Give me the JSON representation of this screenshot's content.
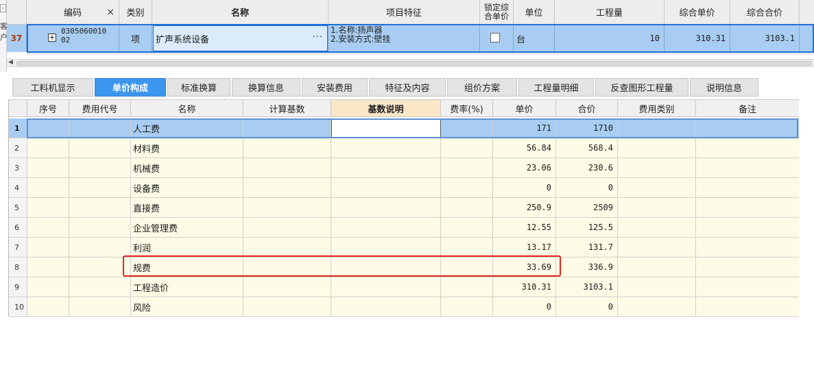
{
  "left_strip": {
    "chars": [
      "客",
      "户"
    ]
  },
  "upper_grid": {
    "headers": {
      "code": "编码",
      "close": "×",
      "category": "类别",
      "name": "名称",
      "feature": "项目特征",
      "lock_line1": "锁定综",
      "lock_line2": "合单价",
      "unit": "单位",
      "quantity": "工程量",
      "composite_unit_price": "综合单价",
      "composite_total": "综合合价"
    },
    "row": {
      "row_number": "37",
      "expand": "+",
      "code_line1": "0305060010",
      "code_line2": "02",
      "category": "项",
      "name": "扩声系统设备",
      "ellipsis": "···",
      "feature_line1": "1.名称:扬声器",
      "feature_line2": "2.安装方式:壁挂",
      "unit": "台",
      "quantity": "10",
      "composite_unit_price": "310.31",
      "composite_total": "3103.1"
    }
  },
  "tabs": [
    {
      "label": "工料机显示",
      "active": false
    },
    {
      "label": "单价构成",
      "active": true
    },
    {
      "label": "标准换算",
      "active": false
    },
    {
      "label": "换算信息",
      "active": false
    },
    {
      "label": "安装费用",
      "active": false
    },
    {
      "label": "特征及内容",
      "active": false
    },
    {
      "label": "组价方案",
      "active": false
    },
    {
      "label": "工程量明细",
      "active": false
    },
    {
      "label": "反查图形工程量",
      "active": false
    },
    {
      "label": "说明信息",
      "active": false
    }
  ],
  "lower_grid": {
    "headers": [
      "序号",
      "费用代号",
      "名称",
      "计算基数",
      "基数说明",
      "费率(%)",
      "单价",
      "合价",
      "费用类别",
      "备注"
    ],
    "rows": [
      {
        "index": "1",
        "name": "人工费",
        "unit_price": "171",
        "total": "1710"
      },
      {
        "index": "2",
        "name": "材料费",
        "unit_price": "56.84",
        "total": "568.4"
      },
      {
        "index": "3",
        "name": "机械费",
        "unit_price": "23.06",
        "total": "230.6"
      },
      {
        "index": "4",
        "name": "设备费",
        "unit_price": "0",
        "total": "0"
      },
      {
        "index": "5",
        "name": "直接费",
        "unit_price": "250.9",
        "total": "2509"
      },
      {
        "index": "6",
        "name": "企业管理费",
        "unit_price": "12.55",
        "total": "125.5"
      },
      {
        "index": "7",
        "name": "利润",
        "unit_price": "13.17",
        "total": "131.7"
      },
      {
        "index": "8",
        "name": "规费",
        "unit_price": "33.69",
        "total": "336.9"
      },
      {
        "index": "9",
        "name": "工程造价",
        "unit_price": "310.31",
        "total": "3103.1"
      },
      {
        "index": "10",
        "name": "风险",
        "unit_price": "0",
        "total": "0"
      }
    ]
  },
  "colors": {
    "selection_blue": "#a9cdf2",
    "active_tab": "#3d96ee",
    "row_fill": "#fefce6",
    "highlight_header": "#fbe6c8",
    "annotation_red": "#e0261a"
  }
}
